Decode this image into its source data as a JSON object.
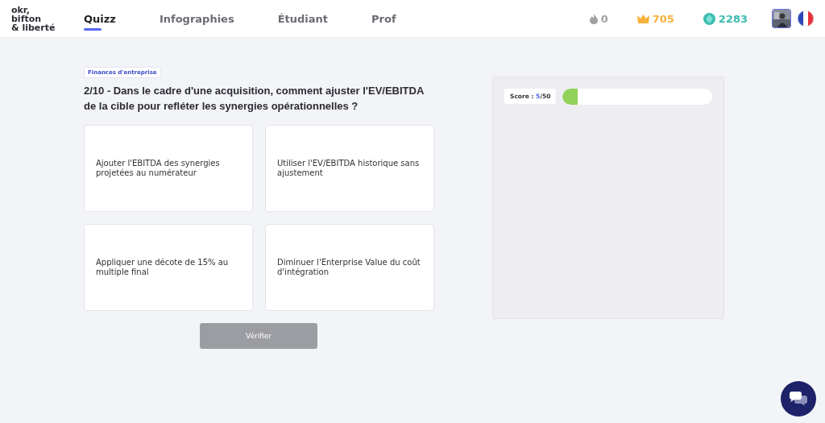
{
  "logo": {
    "lines": [
      "okr,",
      "bifton",
      "& liberté"
    ]
  },
  "nav": [
    {
      "label": "Quizz",
      "selected": true
    },
    {
      "label": "Infographies",
      "selected": false
    },
    {
      "label": "Étudiant",
      "selected": false
    },
    {
      "label": "Prof",
      "selected": false
    }
  ],
  "stats": [
    {
      "kind": "flame",
      "value": "0",
      "color": "#a0a0a0"
    },
    {
      "kind": "crown",
      "value": "705",
      "color": "#f7b23b"
    },
    {
      "kind": "gem",
      "value": "2283",
      "color": "#3bbcb0"
    }
  ],
  "quiz": {
    "category": "Finances d'entreprise",
    "question": "2/10 - Dans le cadre d'une acquisition, comment ajuster l'EV/EBITDA de la cible pour refléter les synergies opérationnelles ?",
    "answers": [
      "Ajouter l'EBITDA des synergies projetées au numérateur",
      "Utiliser l'EV/EBITDA historique sans ajustement",
      "Appliquer une décote de 15% au multiple final",
      "Diminuer l'Enterprise Value du coût d'intégration"
    ],
    "verify_button": {
      "label": "Vérifier",
      "disabled": true
    }
  },
  "score": {
    "text": "Score : **5**/50",
    "level": 0.1
  }
}
